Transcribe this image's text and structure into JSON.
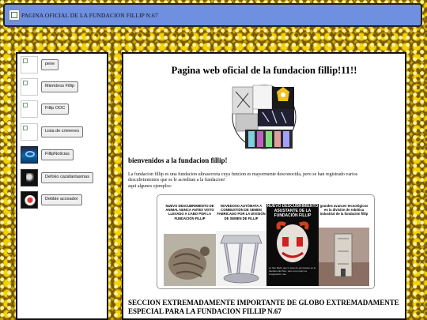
{
  "header": {
    "title": "PAGINA OFICIAL DE LA FUNDACION FILLIP N.67",
    "icon": "broken-image-icon"
  },
  "sidebar": {
    "items": [
      {
        "label": "pene",
        "icon": "broken-image-icon"
      },
      {
        "label": "Miembros Fillip",
        "icon": "broken-image-icon"
      },
      {
        "label": "Fillip OOC",
        "icon": "broken-image-icon"
      },
      {
        "label": "Lista de crimenes",
        "icon": "broken-image-icon"
      },
      {
        "label": "FillipNoticias",
        "icon": "news-logo-icon"
      },
      {
        "label": "Defoko cazafantasmas",
        "icon": "ghost-photo-icon"
      },
      {
        "label": "Debbie acosador",
        "icon": "face-photo-icon"
      }
    ]
  },
  "main": {
    "title": "Pagina web oficial de la fundacion fillip!11!!",
    "welcome": "bienvenidos a la fundacion fillip!",
    "intro_line1": "La fundacion fillip es una fundacion ultrasecreta cuya funcion es mayormente desconocida, pero se han registrado varios",
    "intro_line2": "descubrimientos que se le acreditan a la fundacion!",
    "intro_line3": "aqui algunos ejemplos:",
    "memes": [
      {
        "caption": "NUEVO DESCUBRIMIENTO DE ANIMAL NUNCA ANTES VISTO LLEVADO A CABO POR LA FUNDACIÓN FILLIP",
        "color": "#111111"
      },
      {
        "caption": "NOVEDOSO AUTÓMATA A COMBUSTIÓN DE SEMEN FABRICADO POR LA DIVISIÓN DE SEMEN DE FILLIP",
        "color": "#111111"
      },
      {
        "caption": "NUEVO DESCUBRIMIENTO ASUSTANTE DE LA FUNDACIÓN FILLIP",
        "color": "#ffffff"
      },
      {
        "caption": "grandes avances tecnológicos en la división de robótica industrial de la fundación fillip",
        "color": "#111111"
      }
    ],
    "meme_subtext": "se han fijado que lo cara de pennywise es la bandera de Peru, pero a lo mejor es imaginación mia",
    "section_heading": "SECCION EXTREMADAMENTE IMPORTANTE DE GLOBO EXTREMADAMENTE ESPECIAL PARA LA FUNDACION FILLIP N.67"
  }
}
